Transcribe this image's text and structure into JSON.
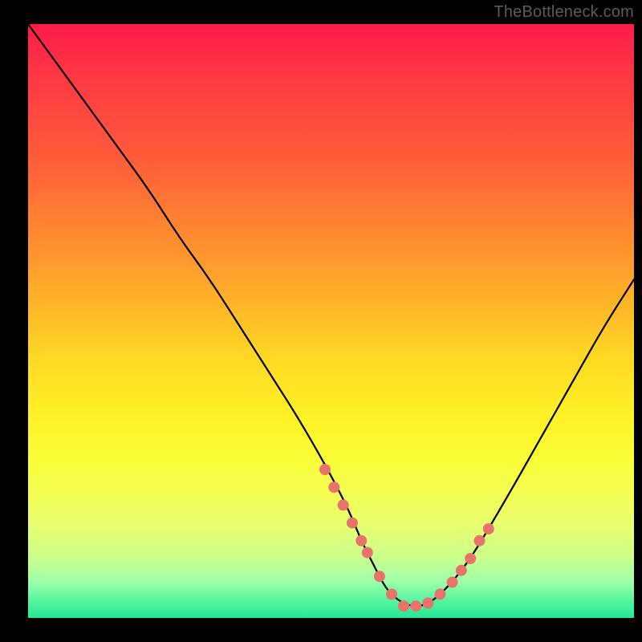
{
  "watermark": "TheBottleneck.com",
  "chart_data": {
    "type": "line",
    "title": "",
    "xlabel": "",
    "ylabel": "",
    "xlim": [
      0,
      100
    ],
    "ylim": [
      0,
      100
    ],
    "curve": {
      "name": "bottleneck-metric",
      "x": [
        0,
        5,
        10,
        15,
        20,
        25,
        30,
        35,
        40,
        45,
        50,
        53,
        55,
        57,
        59,
        61,
        63,
        65,
        67,
        70,
        73,
        76,
        80,
        85,
        90,
        95,
        100
      ],
      "y": [
        100,
        93,
        86,
        79,
        72,
        64,
        57,
        49,
        41,
        33,
        24,
        18,
        13,
        9,
        5,
        3,
        2,
        2,
        3,
        6,
        10,
        15,
        22,
        31,
        40,
        49,
        57
      ]
    },
    "markers": {
      "name": "highlight-dots",
      "color": "#e8736b",
      "radius": 7,
      "x": [
        49,
        50.5,
        52,
        53.5,
        55,
        56,
        58,
        60,
        62,
        64,
        66,
        68,
        70,
        71.5,
        73,
        74.5,
        76
      ],
      "y": [
        25,
        22,
        19,
        16,
        13,
        11,
        7,
        4,
        2,
        2,
        2.5,
        4,
        6,
        8,
        10,
        13,
        15
      ]
    },
    "gradient_note": "Background is a vertical red→yellow→green gradient representing severity; curve dips to near-zero around x≈64."
  }
}
